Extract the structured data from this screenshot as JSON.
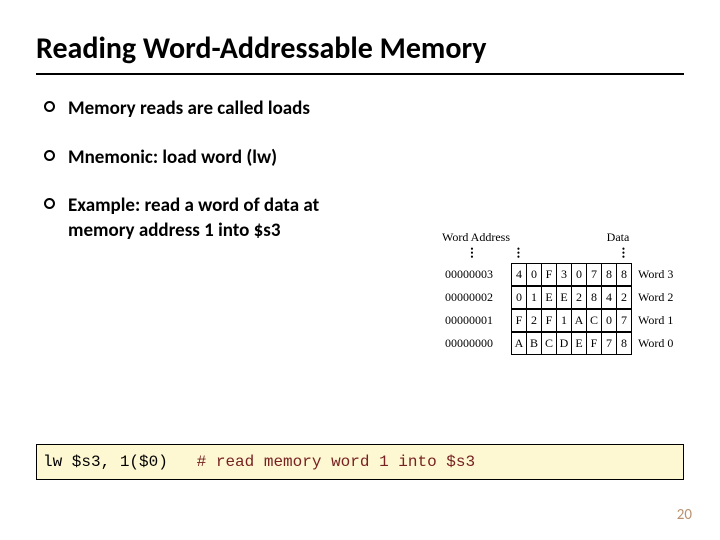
{
  "title": "Reading Word-Addressable Memory",
  "bullets": [
    {
      "lines": [
        "Memory reads are called loads"
      ]
    },
    {
      "lines": [
        "Mnemonic: load word (lw)"
      ]
    },
    {
      "lines": [
        "Example: read a word of data at",
        "memory address 1 into $s3"
      ]
    }
  ],
  "diagram": {
    "header_addr": "Word Address",
    "header_data": "Data",
    "rows": [
      {
        "addr": "00000003",
        "bytes": [
          "4",
          "0",
          "F",
          "3",
          "0",
          "7",
          "8",
          "8"
        ],
        "label": "Word 3"
      },
      {
        "addr": "00000002",
        "bytes": [
          "0",
          "1",
          "E",
          "E",
          "2",
          "8",
          "4",
          "2"
        ],
        "label": "Word 2"
      },
      {
        "addr": "00000001",
        "bytes": [
          "F",
          "2",
          "F",
          "1",
          "A",
          "C",
          "0",
          "7"
        ],
        "label": "Word 1"
      },
      {
        "addr": "00000000",
        "bytes": [
          "A",
          "B",
          "C",
          "D",
          "E",
          "F",
          "7",
          "8"
        ],
        "label": "Word 0"
      }
    ]
  },
  "code": {
    "inst": "lw $s3, 1($0)",
    "comment": "# read memory word 1 into $s3"
  },
  "page_number": "20"
}
